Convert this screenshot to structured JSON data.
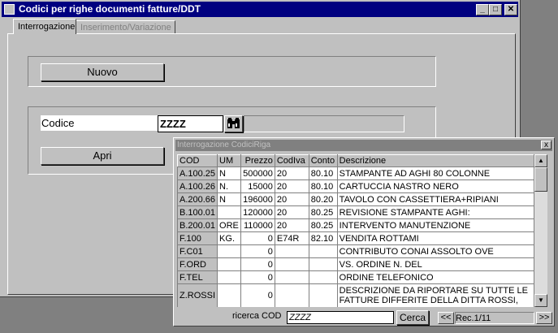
{
  "window": {
    "title": "Codici per righe documenti fatture/DDT",
    "min_glyph": "_",
    "max_glyph": "□",
    "close_glyph": "✕"
  },
  "tabs": [
    {
      "label": "Interrogazione",
      "active": true
    },
    {
      "label": "Inserimento/Variazione",
      "active": false
    }
  ],
  "buttons": {
    "nuovo": "Nuovo",
    "apri": "Apri"
  },
  "codice": {
    "label": "Codice",
    "value": "ZZZZ"
  },
  "lookup": {
    "title": "Interrogazione CodiciRiga",
    "close_glyph": "x",
    "columns": [
      "COD",
      "UM",
      "Prezzo",
      "CodIva",
      "Conto",
      "Descrizione"
    ],
    "rows": [
      {
        "cod": "A.100.25",
        "um": "N",
        "prezzo": "500000",
        "codiva": "20",
        "conto": "80.10",
        "descr": "STAMPANTE AD AGHI 80 COLONNE"
      },
      {
        "cod": "A.100.26",
        "um": "N.",
        "prezzo": "15000",
        "codiva": "20",
        "conto": "80.10",
        "descr": "CARTUCCIA NASTRO NERO"
      },
      {
        "cod": "A.200.66",
        "um": "N",
        "prezzo": "196000",
        "codiva": "20",
        "conto": "80.20",
        "descr": "TAVOLO CON CASSETTIERA+RIPIANI"
      },
      {
        "cod": "B.100.01",
        "um": "",
        "prezzo": "120000",
        "codiva": "20",
        "conto": "80.25",
        "descr": "REVISIONE STAMPANTE AGHI:"
      },
      {
        "cod": "B.200.01",
        "um": "ORE",
        "prezzo": "110000",
        "codiva": "20",
        "conto": "80.25",
        "descr": "INTERVENTO MANUTENZIONE"
      },
      {
        "cod": "F.100",
        "um": "KG.",
        "prezzo": "0",
        "codiva": "E74R",
        "conto": "82.10",
        "descr": "VENDITA ROTTAMI"
      },
      {
        "cod": "F.C01",
        "um": "",
        "prezzo": "0",
        "codiva": "",
        "conto": "",
        "descr": "CONTRIBUTO CONAI ASSOLTO OVE"
      },
      {
        "cod": "F.ORD",
        "um": "",
        "prezzo": "0",
        "codiva": "",
        "conto": "",
        "descr": "VS. ORDINE N.        DEL"
      },
      {
        "cod": "F.TEL",
        "um": "",
        "prezzo": "0",
        "codiva": "",
        "conto": "",
        "descr": "ORDINE TELEFONICO"
      },
      {
        "cod": "Z.ROSSI",
        "um": "",
        "prezzo": "0",
        "codiva": "",
        "conto": "",
        "descr": "DESCRIZIONE DA RIPORTARE SU TUTTE LE FATTURE DIFFERITE DELLA DITTA ROSSI,"
      }
    ],
    "search_label": "ricerca COD",
    "search_value": "ZZZZ",
    "search_button": "Cerca",
    "prev_label": "<<",
    "next_label": ">>",
    "record_status": "Rec.1/11",
    "scroll_up": "▲",
    "scroll_down": "▼"
  }
}
